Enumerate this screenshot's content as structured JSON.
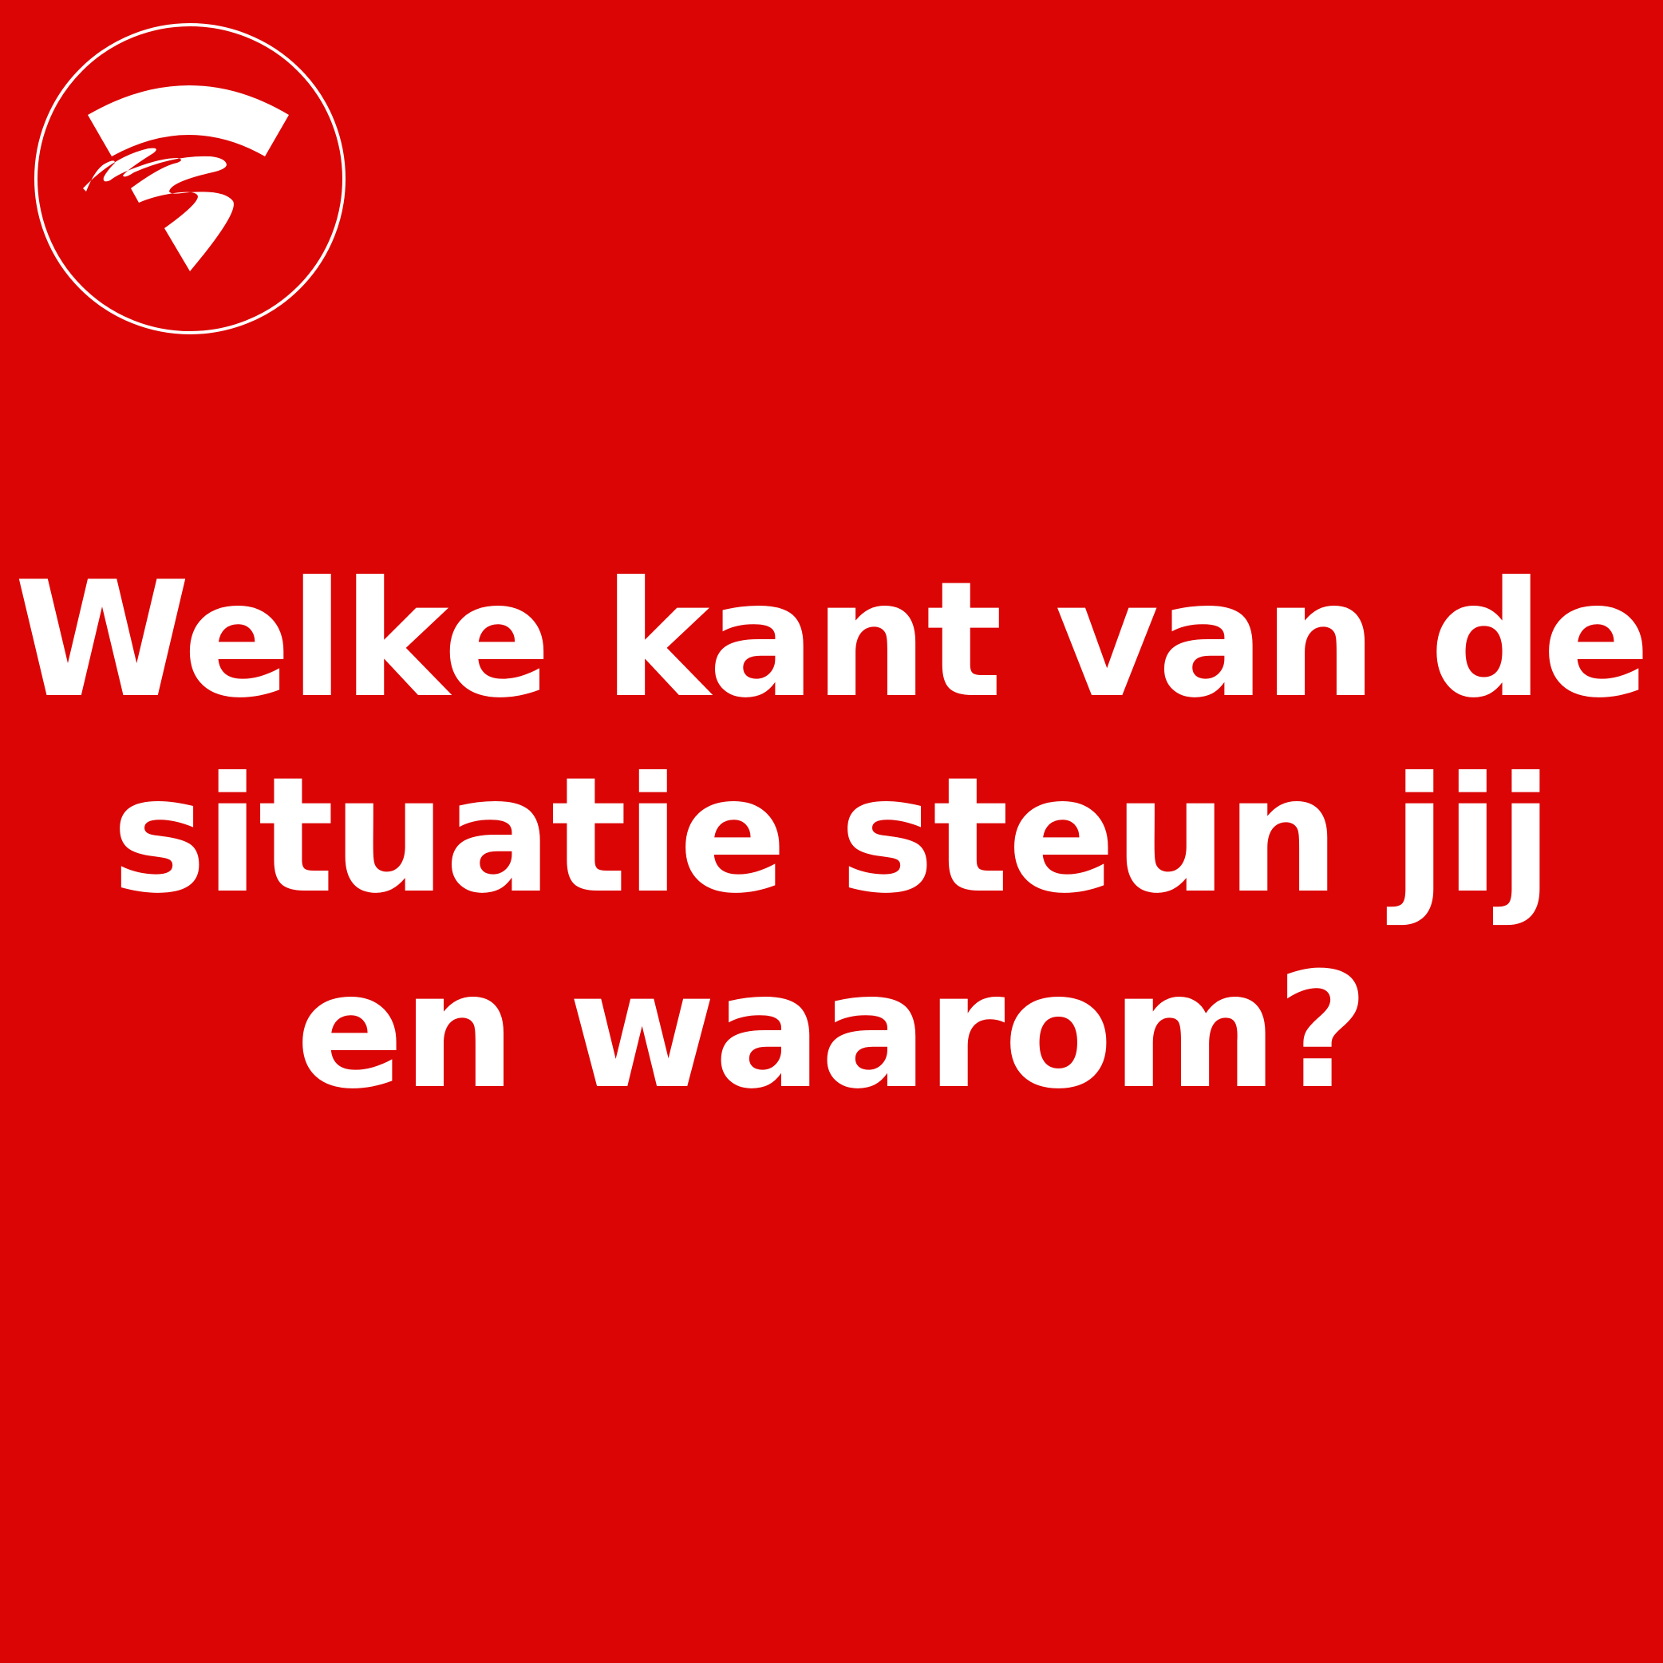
{
  "logo": {
    "icon": "circular-swoosh-logo-icon",
    "color": "#ffffff"
  },
  "question": {
    "lines": [
      "Welke kant van de",
      "situatie steun jij",
      "en waarom?"
    ]
  },
  "colors": {
    "background": "#db0505",
    "text": "#ffffff"
  }
}
